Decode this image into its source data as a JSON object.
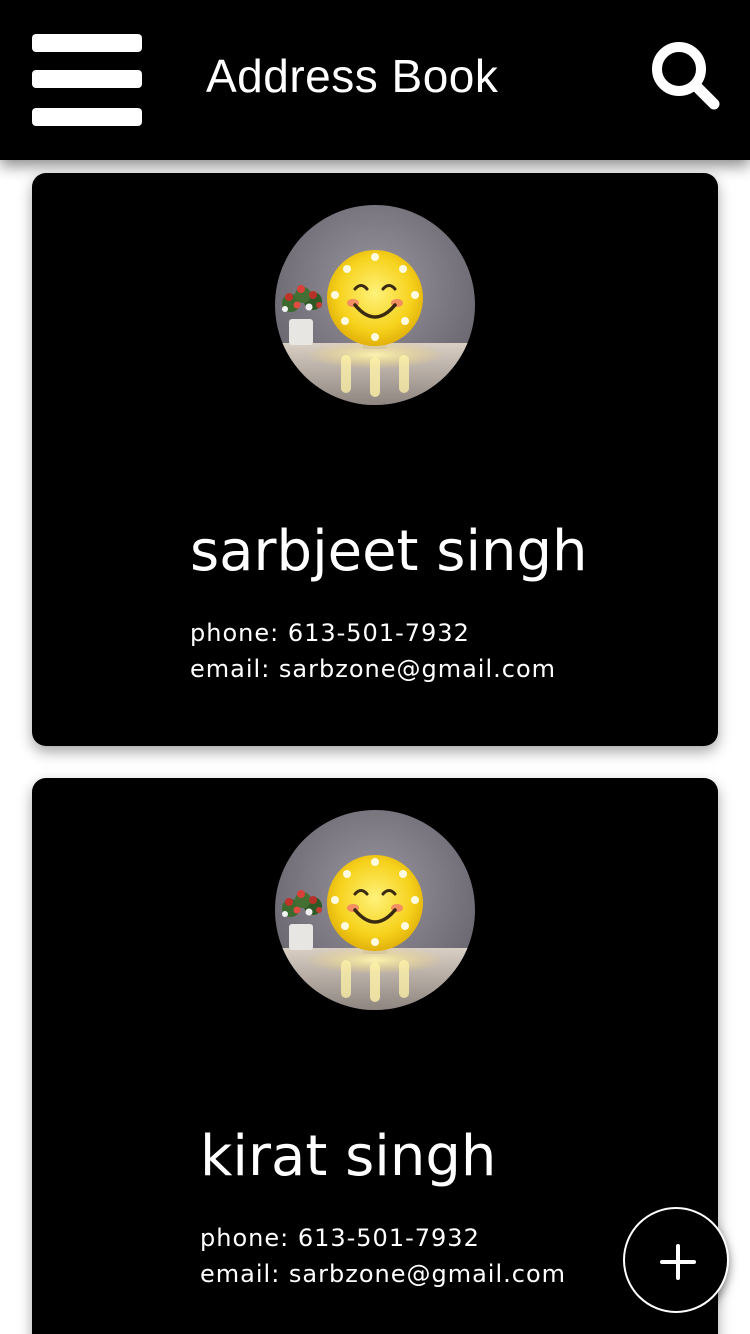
{
  "app_bar": {
    "title": "Address Book",
    "menu_icon": "hamburger-menu-icon",
    "search_icon": "search-icon"
  },
  "contacts": [
    {
      "name": "sarbjeet singh",
      "phone": "phone: 613-501-7932",
      "email": "email: sarbzone@gmail.com",
      "avatar": "smiley-lamp-photo"
    },
    {
      "name": "kirat singh",
      "phone": "phone: 613-501-7932",
      "email": "email: sarbzone@gmail.com",
      "avatar": "smiley-lamp-photo"
    }
  ],
  "fab": {
    "icon": "plus-icon"
  },
  "colors": {
    "app_bar_background": "#000000",
    "card_background": "#000000",
    "text": "#ffffff",
    "page_background": "#ffffff",
    "smiley_yellow": "#f4cf1a"
  }
}
